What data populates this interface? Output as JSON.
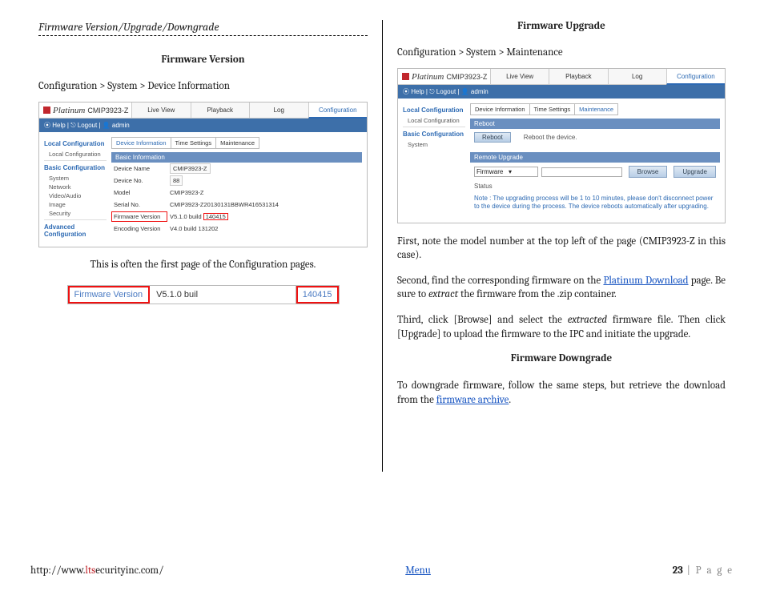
{
  "heading": "Firmware Version/Upgrade/Downgrade",
  "left": {
    "section_title": "Firmware Version",
    "breadcrumb": "Configuration > System > Device Information",
    "shot": {
      "brand": "Platinum",
      "model": "CMIP3923-Z",
      "tabs": [
        "Live View",
        "Playback",
        "Log",
        "Configuration"
      ],
      "active_tab": 3,
      "bluebar": "⦿ Help  |  ⎋ Logout  |  👤 admin",
      "sidebar": {
        "h1": "Local Configuration",
        "i1": "Local Configuration",
        "h2": "Basic Configuration",
        "i2a": "System",
        "i2b": "Network",
        "i2c": "Video/Audio",
        "i2d": "Image",
        "i2e": "Security",
        "h3": "Advanced Configuration"
      },
      "subtabs": [
        "Device Information",
        "Time Settings",
        "Maintenance"
      ],
      "active_subtab": 0,
      "block_title": "Basic Information",
      "rows": {
        "k1": "Device Name",
        "v1": "CMIP3923-Z",
        "k2": "Device No.",
        "v2": "88",
        "k3": "Model",
        "v3": "CMIP3923-Z",
        "k4": "Serial No.",
        "v4": "CMIP3923-Z20130131BBWR416531314",
        "k5": "Firmware Version",
        "v5a": "V5.1.0 build",
        "v5b": "140415",
        "k6": "Encoding Version",
        "v6": "V4.0 build 131202"
      }
    },
    "caption": "This is often the first page of the Configuration pages.",
    "zoom": {
      "a": "Firmware Version",
      "b": "V5.1.0 buil",
      "c": "140415"
    }
  },
  "right": {
    "section_title": "Firmware Upgrade",
    "breadcrumb": "Configuration > System > Maintenance",
    "shot": {
      "brand": "Platinum",
      "model": "CMIP3923-Z",
      "tabs": [
        "Live View",
        "Playback",
        "Log",
        "Configuration"
      ],
      "active_tab": 3,
      "bluebar": "⦿ Help  |  ⎋ Logout  |  👤 admin",
      "sidebar": {
        "h1": "Local Configuration",
        "i1": "Local Configuration",
        "h2": "Basic Configuration",
        "i2a": "System"
      },
      "subtabs": [
        "Device Information",
        "Time Settings",
        "Maintenance"
      ],
      "active_subtab": 2,
      "reboot_header": "Reboot",
      "reboot_btn": "Reboot",
      "reboot_text": "Reboot the device.",
      "upgrade_header": "Remote Upgrade",
      "select_val": "Firmware",
      "browse_btn": "Browse",
      "upgrade_btn": "Upgrade",
      "status_label": "Status",
      "note": "Note :  The upgrading process will be 1 to 10 minutes, please don't disconnect power to the device during the process. The device reboots automatically after upgrading."
    },
    "p1a": "First, note the model number at the top left of the page (CMIP3923-Z in this case).",
    "p2a": "Second, find the corresponding firmware on the ",
    "p2link": "Platinum Download",
    "p2b": " page.  Be sure to ",
    "p2em": "extract",
    "p2c": " the firmware from the .zip container.",
    "p3a": "Third, click [Browse] and select the ",
    "p3em": "extracted",
    "p3b": " firmware file.  Then click [Upgrade] to upload the firmware to the IPC and initiate the upgrade.",
    "downgrade_title": "Firmware Downgrade",
    "p4a": "To downgrade firmware, follow the same steps, but retrieve the download from the ",
    "p4link": "firmware archive",
    "p4b": "."
  },
  "footer": {
    "url_pre": "http://www.",
    "url_red": "lts",
    "url_post": "ecurityinc.com/",
    "menu": "Menu",
    "page_num": "23",
    "page_label": "P a g e"
  }
}
